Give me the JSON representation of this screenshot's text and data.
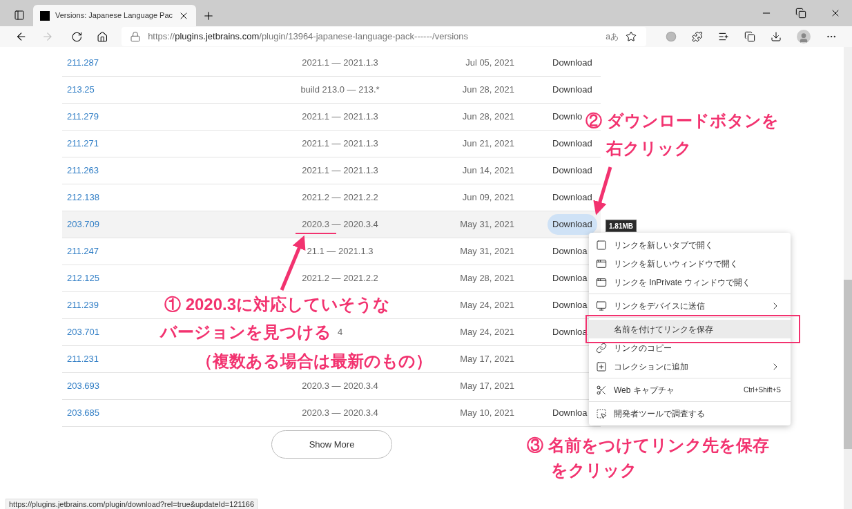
{
  "browser": {
    "tab_title": "Versions: Japanese Language Pac",
    "url_scheme": "https://",
    "url_host": "plugins.jetbrains.com",
    "url_path": "/plugin/13964-japanese-language-pack------/versions",
    "read_aloud": "aあ"
  },
  "versions": [
    {
      "version": "211.287",
      "range": "2021.1 — 2021.1.3",
      "date": "Jul 05, 2021",
      "download": "Download",
      "highlighted": false
    },
    {
      "version": "213.25",
      "range": "build 213.0 — 213.*",
      "date": "Jun 28, 2021",
      "download": "Download",
      "highlighted": false
    },
    {
      "version": "211.279",
      "range": "2021.1 — 2021.1.3",
      "date": "Jun 28, 2021",
      "download": "Downlo",
      "highlighted": false
    },
    {
      "version": "211.271",
      "range": "2021.1 — 2021.1.3",
      "date": "Jun 21, 2021",
      "download": "Download",
      "highlighted": false
    },
    {
      "version": "211.263",
      "range": "2021.1 — 2021.1.3",
      "date": "Jun 14, 2021",
      "download": "Download",
      "highlighted": false
    },
    {
      "version": "212.138",
      "range": "2021.2 — 2021.2.2",
      "date": "Jun 09, 2021",
      "download": "Download",
      "highlighted": false
    },
    {
      "version": "203.709",
      "range": "2020.3 — 2020.3.4",
      "date": "May 31, 2021",
      "download": "Download",
      "highlighted": true
    },
    {
      "version": "211.247",
      "range": "21.1 — 2021.1.3",
      "date": "May 31, 2021",
      "download": "Downloa",
      "highlighted": false
    },
    {
      "version": "212.125",
      "range": "2021.2 — 2021.2.2",
      "date": "May 28, 2021",
      "download": "Downloa",
      "highlighted": false
    },
    {
      "version": "211.239",
      "date": "May 24, 2021",
      "download": "Downloa",
      "highlighted": false
    },
    {
      "version": "203.701",
      "range": "4",
      "date": "May 24, 2021",
      "download": "Downloa",
      "highlighted": false
    },
    {
      "version": "211.231",
      "date": "May 17, 2021",
      "highlighted": false
    },
    {
      "version": "203.693",
      "range": "2020.3 — 2020.3.4",
      "date": "May 17, 2021",
      "highlighted": false
    },
    {
      "version": "203.685",
      "range": "2020.3 — 2020.3.4",
      "date": "May 10, 2021",
      "download": "Downloa",
      "highlighted": false
    }
  ],
  "tooltip": "1.81MB",
  "context_menu": [
    [
      {
        "label": "リンクを新しいタブで開く",
        "selected": false
      },
      {
        "label": "リンクを新しいウィンドウで開く",
        "selected": false
      },
      {
        "label": "リンクを InPrivate ウィンドウで開く",
        "selected": false
      }
    ],
    [
      {
        "label": "リンクをデバイスに送信",
        "selected": false,
        "submenu": true
      }
    ],
    [
      {
        "label": "名前を付けてリンクを保存",
        "selected": true
      },
      {
        "label": "リンクのコピー",
        "selected": false
      },
      {
        "label": "コレクションに追加",
        "selected": false,
        "submenu": true
      }
    ],
    [
      {
        "label": "Web キャプチャ",
        "shortcut": "Ctrl+Shift+S",
        "selected": false
      }
    ],
    [
      {
        "label": "開発者ツールで調査する",
        "selected": false
      }
    ]
  ],
  "annotations": [
    {
      "lines": [
        "① 2020.3に対応していそうな",
        "バージョンを見つける",
        "（複数ある場合は最新のもの）"
      ]
    },
    {
      "lines": [
        "② ダウンロードボタンを",
        "右クリック"
      ]
    },
    {
      "lines": [
        "③ 名前をつけてリンク先を保存",
        "をクリック"
      ]
    }
  ],
  "show_more": "Show More",
  "status_url": "https://plugins.jetbrains.com/plugin/download?rel=true&updateId=121166"
}
